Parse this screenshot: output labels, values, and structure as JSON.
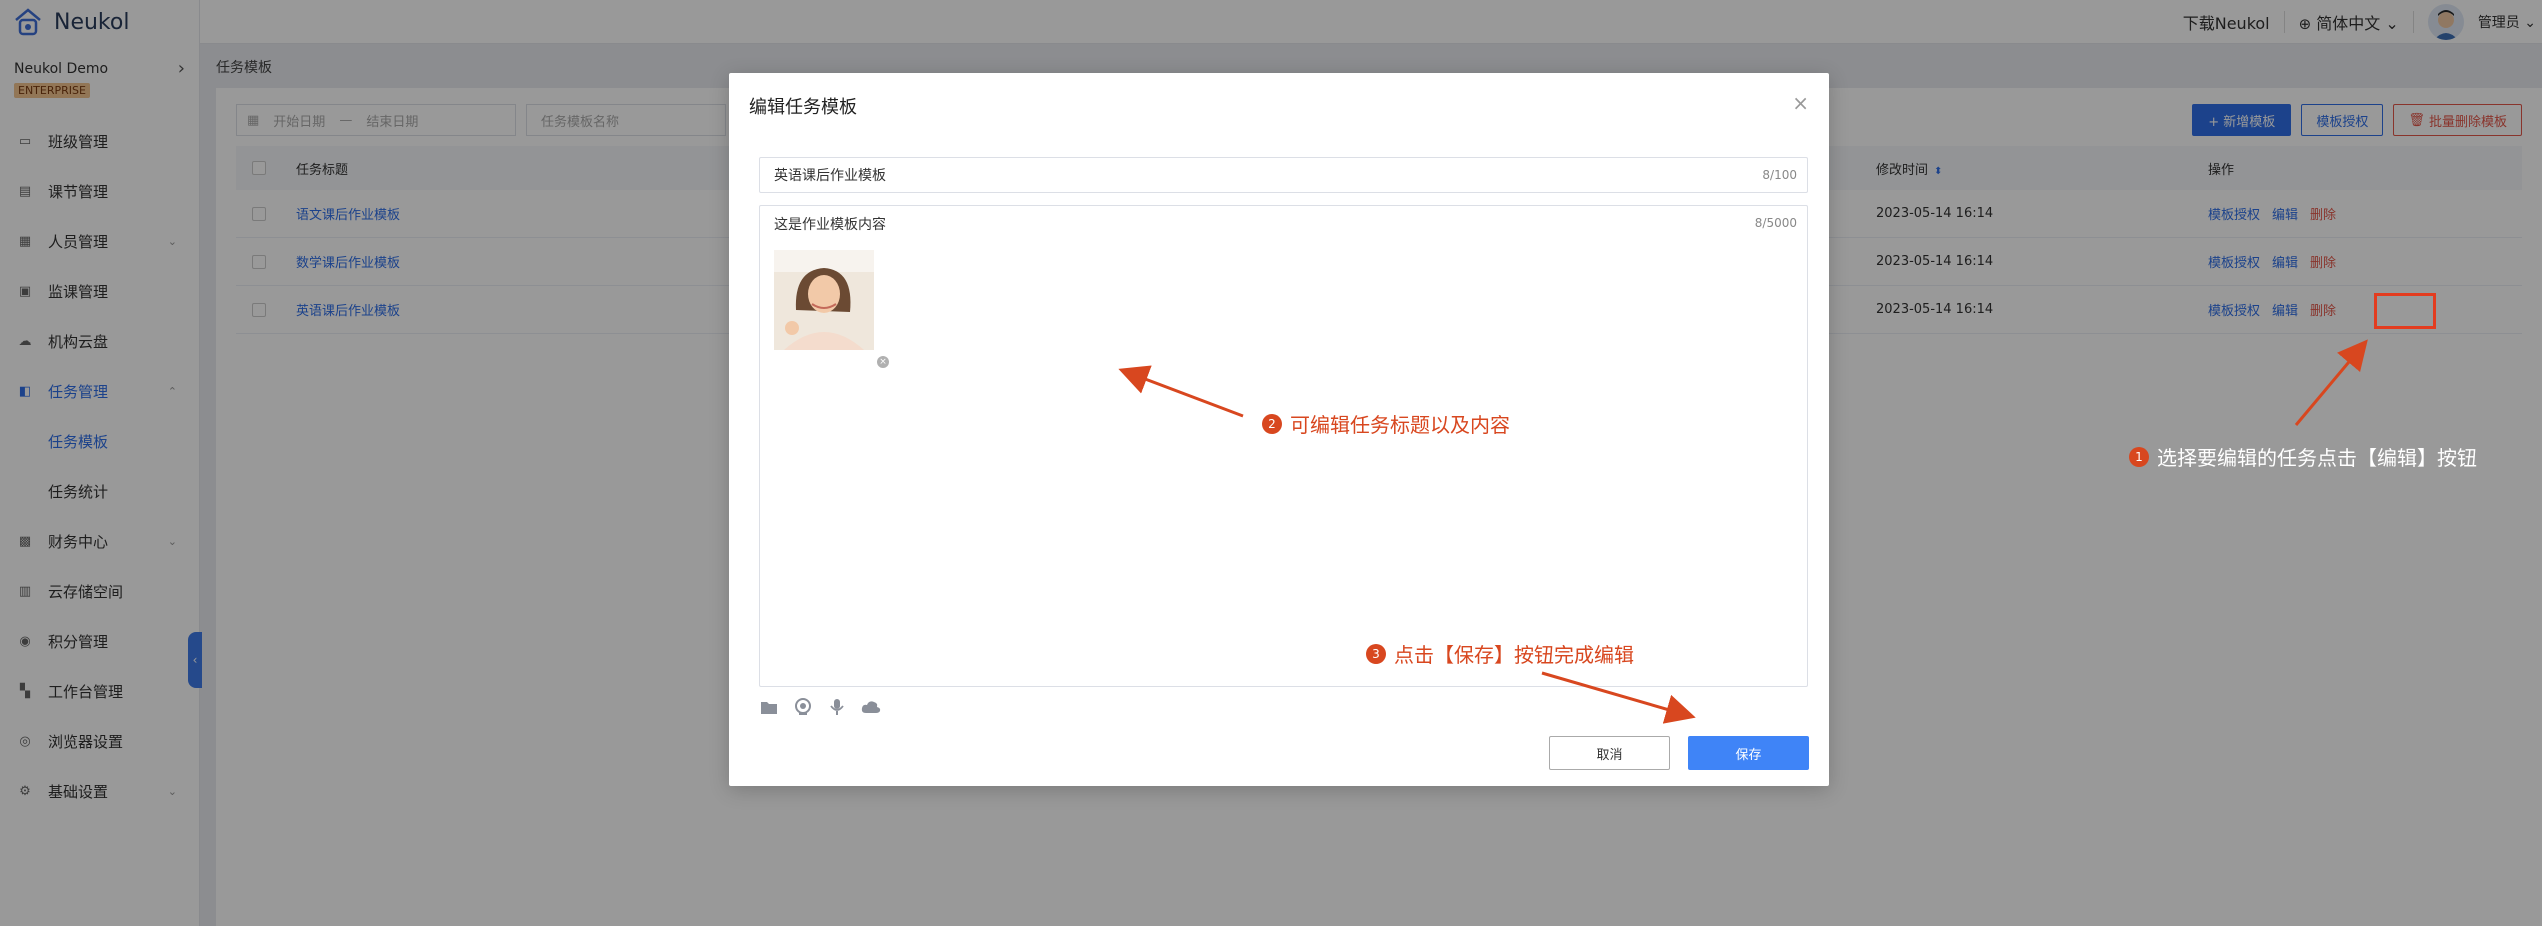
{
  "app": {
    "brand": "Neukol",
    "org_name": "Neukol Demo",
    "edition_badge": "ENTERPRISE"
  },
  "topbar": {
    "download": "下载Neukol",
    "language": "简体中文",
    "user": "管理员"
  },
  "sidebar": {
    "items": [
      {
        "label": "班级管理",
        "icon": "class-icon"
      },
      {
        "label": "课节管理",
        "icon": "lesson-icon"
      },
      {
        "label": "人员管理",
        "icon": "people-icon"
      },
      {
        "label": "监课管理",
        "icon": "monitor-icon"
      },
      {
        "label": "机构云盘",
        "icon": "cloud-drive-icon"
      },
      {
        "label": "任务管理",
        "icon": "task-icon"
      },
      {
        "label": "财务中心",
        "icon": "finance-icon"
      },
      {
        "label": "云存储空间",
        "icon": "storage-icon"
      },
      {
        "label": "积分管理",
        "icon": "points-icon"
      },
      {
        "label": "工作台管理",
        "icon": "workbench-icon"
      },
      {
        "label": "浏览器设置",
        "icon": "browser-icon"
      },
      {
        "label": "基础设置",
        "icon": "settings-icon"
      }
    ],
    "task_sub": [
      "任务模板",
      "任务统计"
    ]
  },
  "page": {
    "breadcrumb": "任务模板",
    "filter": {
      "start_placeholder": "开始日期",
      "range_sep": "—",
      "end_placeholder": "结束日期",
      "name_placeholder": "任务模板名称"
    },
    "buttons": {
      "add": "+ 新增模板",
      "authorize": "模板授权",
      "batch_delete": "批量删除模板"
    },
    "table": {
      "col_title": "任务标题",
      "col_time": "修改时间",
      "col_ops": "操作",
      "rows": [
        {
          "title": "语文课后作业模板",
          "time": "2023-05-14 16:14"
        },
        {
          "title": "数学课后作业模板",
          "time": "2023-05-14 16:14"
        },
        {
          "title": "英语课后作业模板",
          "time": "2023-05-14 16:14"
        }
      ],
      "op_authorize": "模板授权",
      "op_edit": "编辑",
      "op_delete": "删除"
    }
  },
  "dialog": {
    "title": "编辑任务模板",
    "title_value": "英语课后作业模板",
    "title_count": "8/100",
    "content_value": "这是作业模板内容",
    "content_count": "8/5000",
    "cancel": "取消",
    "save": "保存"
  },
  "annotations": {
    "step1": {
      "num": "1",
      "text": "选择要编辑的任务点击【编辑】按钮"
    },
    "step2": {
      "num": "2",
      "text": "可编辑任务标题以及内容"
    },
    "step3": {
      "num": "3",
      "text": "点击【保存】按钮完成编辑"
    }
  },
  "colors": {
    "accent": "#2f6fe8",
    "danger": "#e4574a",
    "annotation": "#d8471f"
  }
}
